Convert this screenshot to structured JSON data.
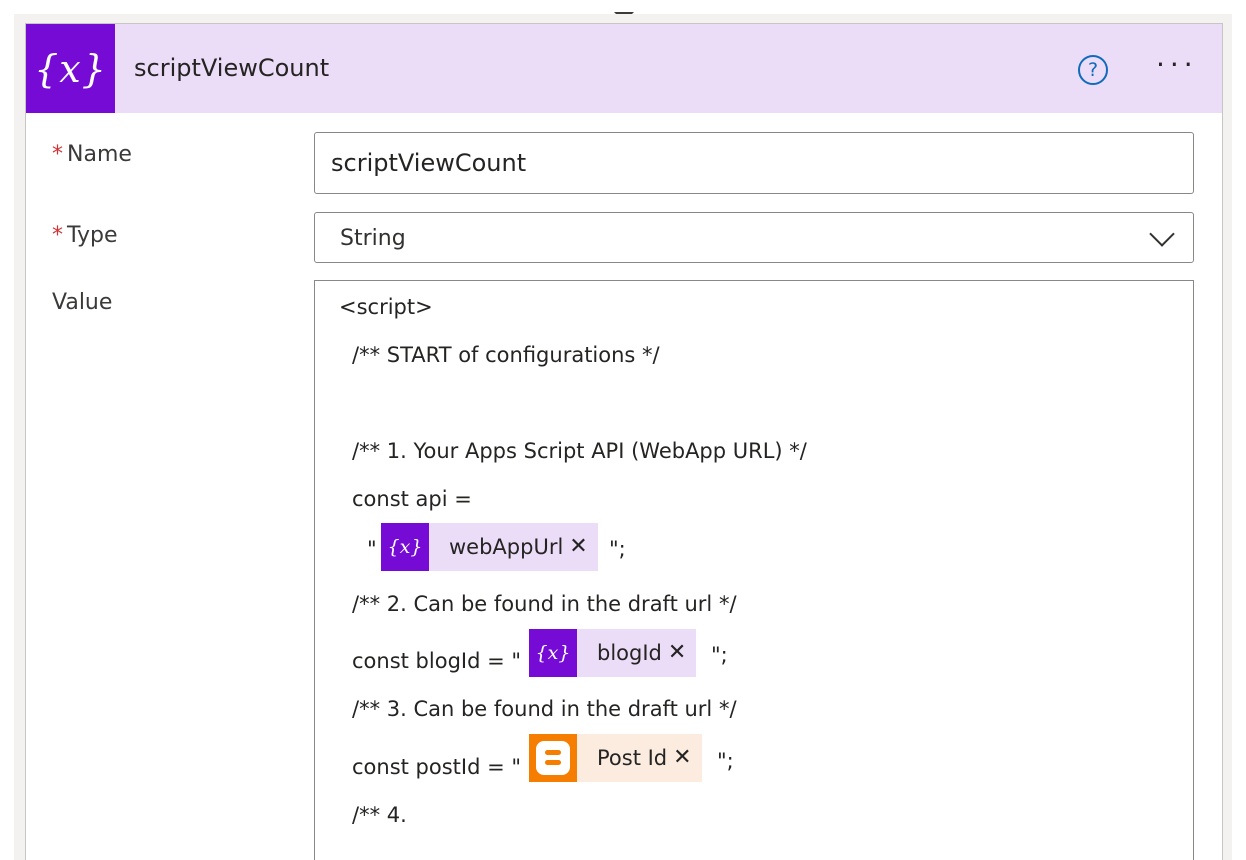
{
  "card": {
    "title": "scriptViewCount",
    "icon": "variable-icon",
    "icon_glyph": "{𝑥}",
    "help_glyph": "?",
    "more_glyph": "···"
  },
  "fields": {
    "name": {
      "required_mark": "*",
      "label": "Name",
      "value": "scriptViewCount"
    },
    "type": {
      "required_mark": "*",
      "label": "Type",
      "value": "String"
    },
    "value": {
      "label": "Value"
    }
  },
  "code": {
    "line1": "<script>",
    "line2": "/** START of configurations */",
    "line3": "/** 1. Your Apps Script API (WebApp URL) */",
    "line4": "const api =",
    "line5_prefix": "\"",
    "line5_suffix": "\";",
    "line6": "/** 2. Can be found in the draft url */",
    "line7_prefix": "const blogId = \"",
    "line7_suffix": "\";",
    "line8": "/** 3. Can be found in the draft url */",
    "line9_prefix": "const postId = \"",
    "line9_suffix": "\";",
    "line10": "/** 4."
  },
  "tokens": {
    "web_app_url": {
      "label": "webAppUrl",
      "remove": "✕",
      "glyph": "{𝑥}"
    },
    "blog_id": {
      "label": "blogId",
      "remove": "✕",
      "glyph": "{𝑥}"
    },
    "post_id": {
      "label": "Post Id",
      "remove": "✕"
    }
  },
  "colors": {
    "variable_accent": "#770bd6",
    "variable_bg": "#ebdcf7",
    "blogger_accent": "#f57d00",
    "blogger_bg": "#fcece0",
    "help_blue": "#0f6cbd",
    "required_red": "#d13438"
  }
}
